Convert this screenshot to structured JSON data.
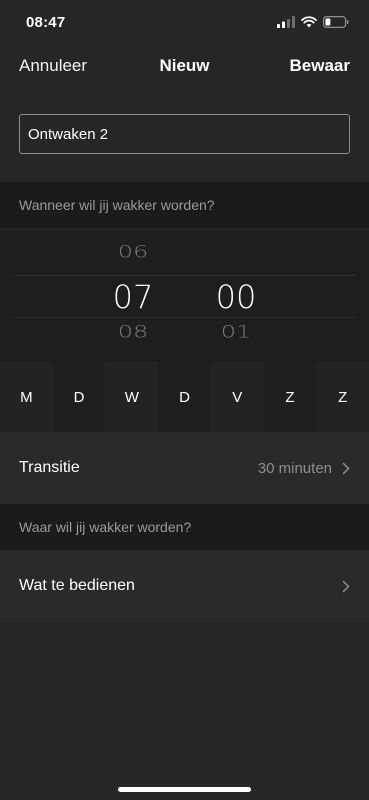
{
  "status_bar": {
    "time": "08:47"
  },
  "nav": {
    "cancel": "Annuleer",
    "title": "Nieuw",
    "save": "Bewaar"
  },
  "alarm_name": {
    "value": "Ontwaken 2"
  },
  "when_header": "Wanneer wil jij wakker worden?",
  "time_picker": {
    "hours": {
      "prev": "06",
      "selected": "07",
      "next": "08"
    },
    "minutes": {
      "selected": "00",
      "next": "01"
    }
  },
  "days": [
    "M",
    "D",
    "W",
    "D",
    "V",
    "Z",
    "Z"
  ],
  "transition": {
    "label": "Transitie",
    "value": "30 minuten"
  },
  "where_header": "Waar wil jij wakker worden?",
  "control": {
    "label": "Wat te bedienen"
  }
}
